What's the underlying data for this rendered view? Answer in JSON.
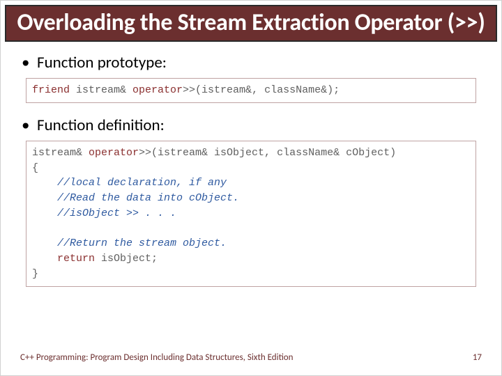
{
  "title": "Overloading the Stream Extraction Operator (>>)",
  "bullets": {
    "prototype": "Function prototype:",
    "definition": "Function definition:"
  },
  "code": {
    "proto_kw1": "friend",
    "proto_t1": " istream& ",
    "proto_kw2": "operator",
    "proto_t2": ">>(istream&, className&);",
    "def_t1": "istream& ",
    "def_kw1": "operator",
    "def_t2": ">>(istream& isObject, className& cObject)",
    "def_brace_open": "{",
    "def_c1": "//local declaration, if any",
    "def_c2": "//Read the data into cObject.",
    "def_c3": "//isObject >> . . .",
    "def_c4": "//Return the stream object.",
    "def_indent": "    ",
    "def_kw2": "return",
    "def_t3": " isObject;",
    "def_brace_close": "}"
  },
  "footer": {
    "text": "C++ Programming: Program Design Including Data Structures, Sixth Edition",
    "page": "17"
  }
}
